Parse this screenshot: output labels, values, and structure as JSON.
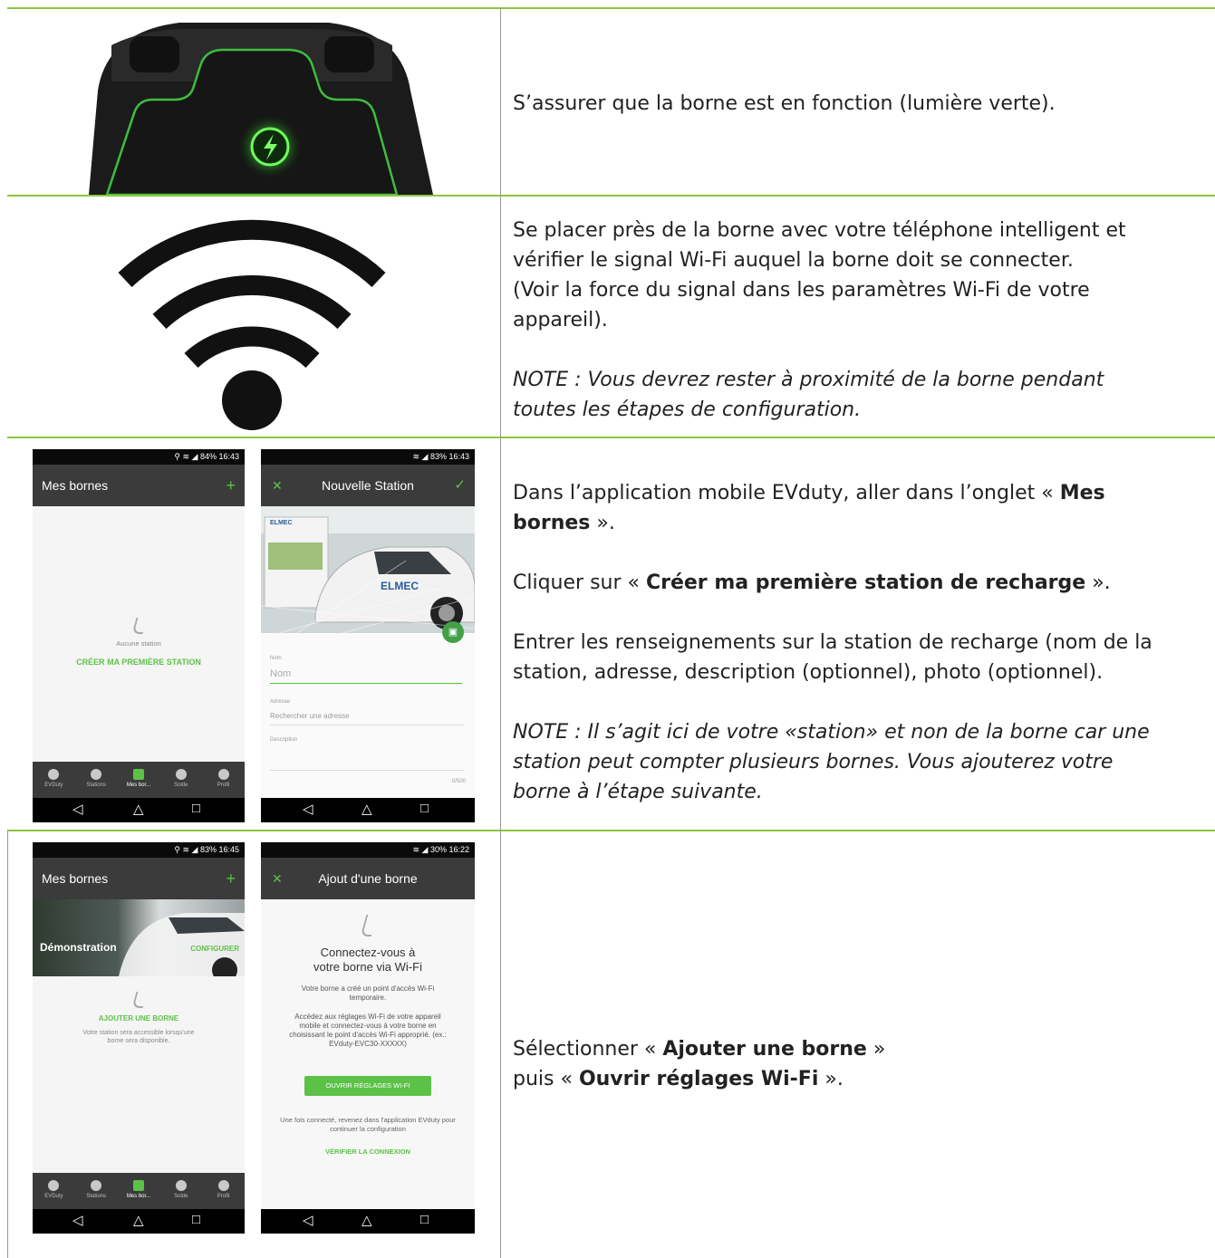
{
  "rows": {
    "r1": {
      "text": "S’assurer que la borne est en fonction (lumière verte)."
    },
    "r2": {
      "line1": "Se placer près de la borne avec votre téléphone intelligent et",
      "line2": "vérifier le signal Wi-Fi auquel la borne doit se connecter.",
      "line3": "(Voir la force du signal dans les paramètres Wi-Fi de votre",
      "line4": "appareil).",
      "note1": "NOTE : Vous devrez rester à proximité de la borne pendant",
      "note2": "toutes les étapes de configuration."
    },
    "r3": {
      "p1_pre": "Dans l’application mobile EVduty, aller dans l’onglet « ",
      "p1_bold1": "Mes",
      "p1_bold2": "bornes",
      "p1_post": " ».",
      "p2_pre": "Cliquer sur « ",
      "p2_bold": "Créer ma première station de recharge",
      "p2_post": " ».",
      "p3_line1": "Entrer les renseignements sur la station de recharge (nom de la",
      "p3_line2": "station, adresse, description (optionnel), photo (optionnel).",
      "note1": "NOTE : Il s’agit ici de votre «station» et non de la borne car une",
      "note2": "station peut compter plusieurs bornes. Vous ajouterez votre",
      "note3": "borne à l’étape suivante."
    },
    "r4": {
      "l1_pre": "Sélectionner « ",
      "l1_bold": "Ajouter une borne",
      "l1_post": " »",
      "l2_pre": "puis « ",
      "l2_bold": "Ouvrir réglages Wi-Fi",
      "l2_post": " »."
    }
  },
  "phones": {
    "a": {
      "status": "84% 16:43",
      "title": "Mes bornes",
      "add": "+",
      "empty": "Aucune station",
      "cta": "CRÉER MA PREMIÈRE STATION",
      "tabs": [
        "EVDuty",
        "Stations",
        "Mes bor...",
        "Solde",
        "Profil"
      ]
    },
    "b": {
      "status": "83% 16:43",
      "close": "✕",
      "title": "Nouvelle Station",
      "check": "✓",
      "brand": "ELMEC",
      "nom_label": "Nom",
      "nom_placeholder": "Nom",
      "adresse_label": "Adresse",
      "adresse_placeholder": "Rechercher une adresse",
      "desc_label": "Description",
      "counter": "0/500"
    },
    "c": {
      "status": "83% 16:45",
      "title": "Mes bornes",
      "add": "+",
      "station": "Démonstration",
      "configure": "CONFIGURER",
      "cta": "AJOUTER UNE BORNE",
      "info": "Votre station sera accessible lorsqu'une borne sera disponible.",
      "tabs": [
        "EVDuty",
        "Stations",
        "Mes bor...",
        "Solde",
        "Profil"
      ]
    },
    "d": {
      "status": "30% 16:22",
      "close": "✕",
      "title": "Ajout d'une borne",
      "heading1": "Connectez-vous à",
      "heading2": "votre borne via Wi-Fi",
      "p1": "Votre borne a créé un point d'accès Wi-Fi temporaire.",
      "p2": "Accédez aux réglages Wi-Fi de votre appareil mobile et connectez-vous à votre borne en choisissant le point d'accès Wi-Fi approprié. (ex.: EVduty-EVC30-XXXXX)",
      "button": "OUVRIR RÉGLAGES WI-FI",
      "p3": "Une fois connecté, revenez dans l'application EVduty pour continuer la configuration",
      "verify": "VÉRIFIER LA CONNEXION"
    },
    "nav": [
      "◁",
      "△",
      "□"
    ]
  },
  "colors": {
    "accent_green": "#5cc247",
    "rule_green": "#8dc63f",
    "appbar": "#3b3b3b"
  }
}
